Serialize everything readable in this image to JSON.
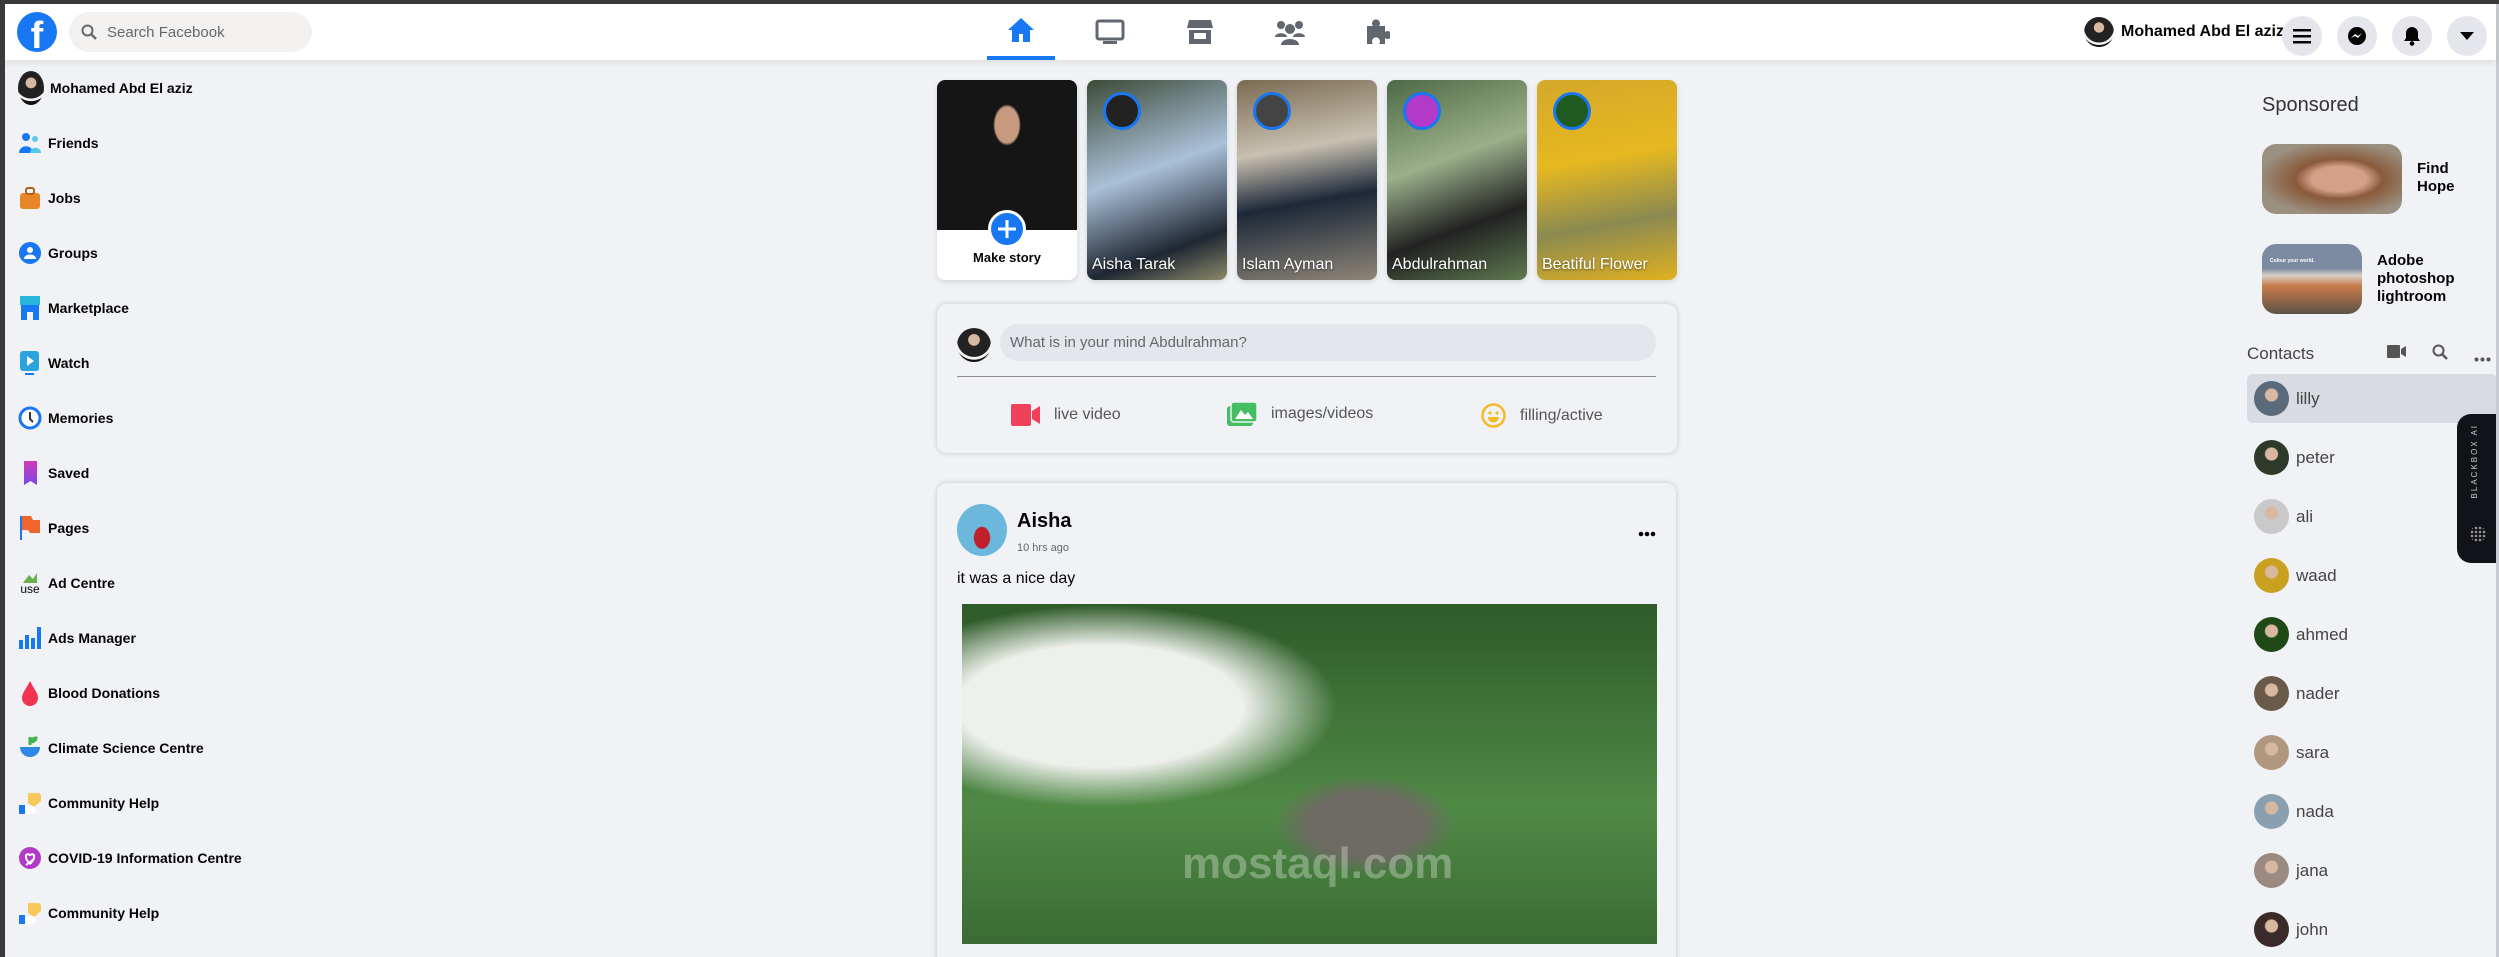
{
  "header": {
    "search_placeholder": "Search Facebook",
    "user_name": "Mohamed Abd El aziz",
    "nav": [
      {
        "name": "home",
        "active": true
      },
      {
        "name": "watch"
      },
      {
        "name": "marketplace"
      },
      {
        "name": "groups"
      },
      {
        "name": "gaming"
      }
    ]
  },
  "sidebar": {
    "profile": "Mohamed Abd El aziz",
    "items": [
      "Friends",
      "Jobs",
      "Groups",
      "Marketplace",
      "Watch",
      "Memories",
      "Saved",
      "Pages",
      "Ad Centre",
      "Ads Manager",
      "Blood Donations",
      "Climate Science Centre",
      "Community Help",
      "COVID-19 Information Centre",
      "Community Help"
    ],
    "broken_icon_alt": "use"
  },
  "stories": {
    "make_story": "Make story",
    "items": [
      "Aisha Tarak",
      "Islam Ayman",
      "Abdulrahman",
      "Beatiful Flower"
    ]
  },
  "composer": {
    "placeholder": "What is in your mind Abdulrahman?",
    "actions": [
      "live video",
      "images/videos",
      "filling/active"
    ]
  },
  "post": {
    "author": "Aisha",
    "time": "10 hrs ago",
    "text": "it was a nice day",
    "watermark": "mostaql.com"
  },
  "sponsored": {
    "title": "Sponsored",
    "ads": [
      "Find Hope",
      "Adobe photoshop lightroom"
    ],
    "ad2_image_text": "Colour your world."
  },
  "contacts": {
    "title": "Contacts",
    "items": [
      "lilly",
      "peter",
      "ali",
      "waad",
      "ahmed",
      "nader",
      "sara",
      "nada",
      "jana",
      "john"
    ]
  },
  "widget": {
    "label": "BLACKBOX AI"
  },
  "colors": {
    "accent": "#1877f2",
    "bg": "#f0f2f5"
  }
}
